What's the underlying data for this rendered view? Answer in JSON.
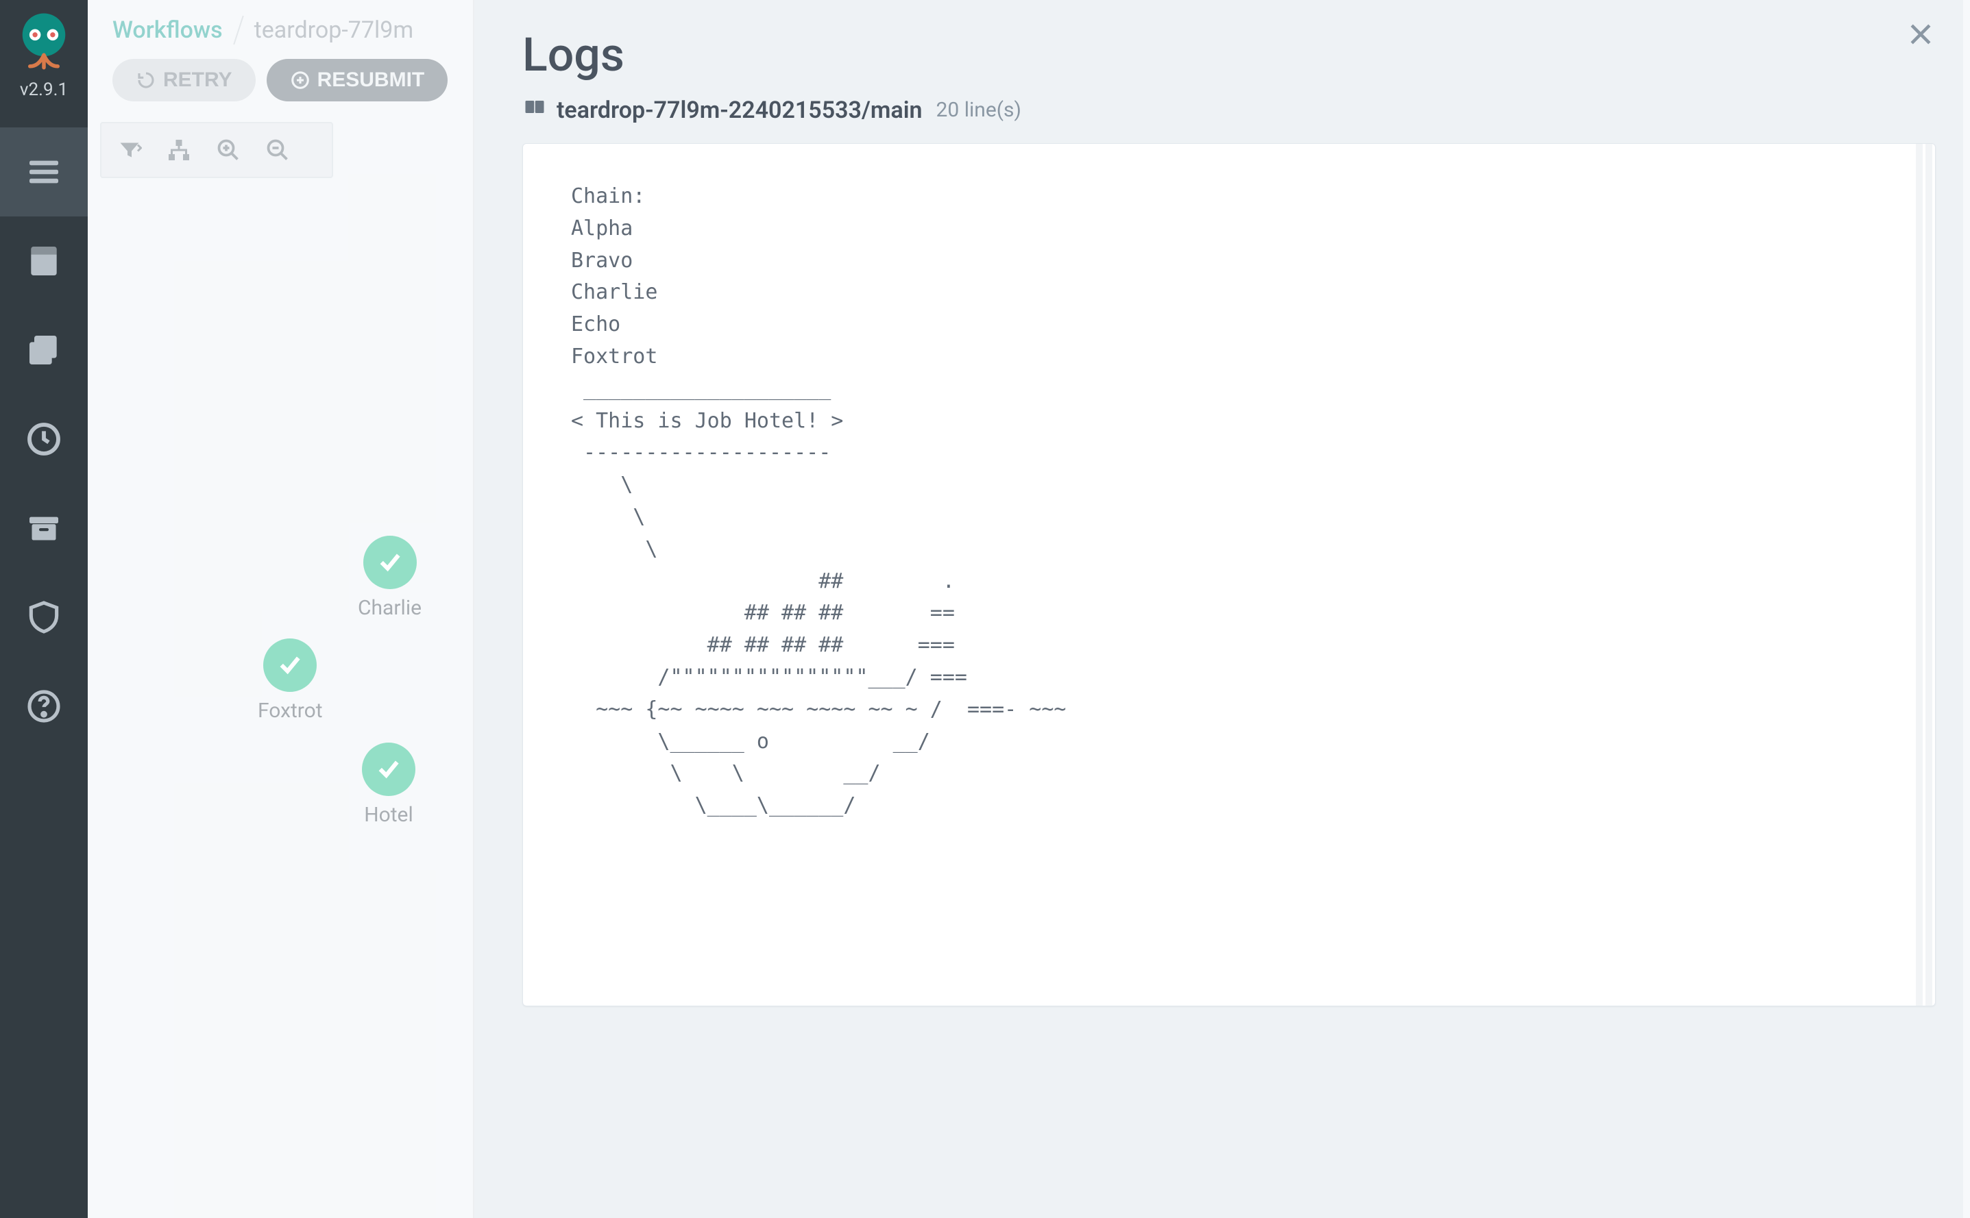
{
  "sidebar": {
    "version": "v2.9.1",
    "items": [
      {
        "name": "menu-icon"
      },
      {
        "name": "file-icon"
      },
      {
        "name": "files-icon"
      },
      {
        "name": "clock-icon"
      },
      {
        "name": "archive-icon"
      },
      {
        "name": "shield-icon"
      },
      {
        "name": "help-icon"
      }
    ]
  },
  "breadcrumb": {
    "root": "Workflows",
    "current": "teardrop-77l9m"
  },
  "toolbar": {
    "retry_label": "RETRY",
    "resubmit_label": "RESUBMIT"
  },
  "graph": {
    "nodes": [
      {
        "id": "charlie",
        "label": "Charlie",
        "status": "success"
      },
      {
        "id": "foxtrot",
        "label": "Foxtrot",
        "status": "success"
      },
      {
        "id": "hotel",
        "label": "Hotel",
        "status": "success"
      }
    ]
  },
  "logs_panel": {
    "title": "Logs",
    "container_name": "teardrop-77l9m-2240215533/main",
    "line_count_label": "20 line(s)",
    "content": "Chain:\nAlpha\nBravo\nCharlie\nEcho\nFoxtrot\n ____________________\n< This is Job Hotel! >\n --------------------\n    \\\n     \\\n      \\\n                    ##        .\n              ## ## ##       ==\n           ## ## ## ##      ===\n       /\"\"\"\"\"\"\"\"\"\"\"\"\"\"\"\"___/ ===\n  ~~~ {~~ ~~~~ ~~~ ~~~~ ~~ ~ /  ===- ~~~\n       \\______ o          __/\n        \\    \\        __/\n          \\____\\______/"
  }
}
